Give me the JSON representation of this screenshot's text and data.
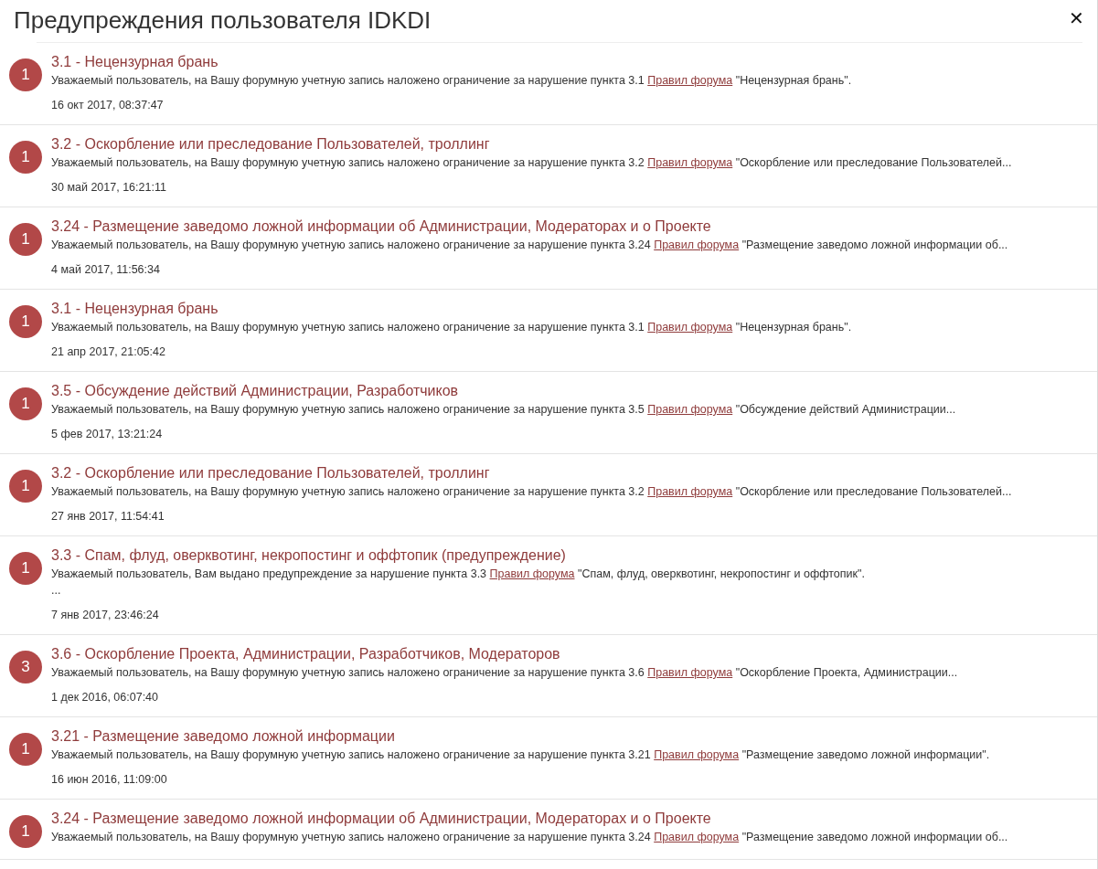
{
  "dialog": {
    "title": "Предупреждения пользователя IDKDI",
    "close": "✕"
  },
  "warnings": [
    {
      "count": "1",
      "title": "3.1 - Нецензурная брань",
      "body_before": "Уважаемый пользователь, на Вашу форумную учетную запись наложено ограничение за нарушение пункта 3.1",
      "link": "Правил форума",
      "body_after": "\"Нецензурная брань\".",
      "date": "16 окт 2017, 08:37:47"
    },
    {
      "count": "1",
      "title": "3.2 - Оскорбление или преследование Пользователей, троллинг",
      "body_before": "Уважаемый пользователь, на Вашу форумную учетную запись наложено ограничение за нарушение пункта 3.2",
      "link": "Правил форума",
      "body_after": "\"Оскорбление или преследование Пользователей...",
      "date": "30 май 2017, 16:21:11"
    },
    {
      "count": "1",
      "title": "3.24 - Размещение заведомо ложной информации об Администрации, Модераторах и о Проекте",
      "body_before": "Уважаемый пользователь, на Вашу форумную учетную запись наложено ограничение за нарушение пункта 3.24",
      "link": "Правил форума",
      "body_after": "\"Размещение заведомо ложной информации об...",
      "date": "4 май 2017, 11:56:34"
    },
    {
      "count": "1",
      "title": "3.1 - Нецензурная брань",
      "body_before": "Уважаемый пользователь, на Вашу форумную учетную запись наложено ограничение за нарушение пункта 3.1",
      "link": "Правил форума",
      "body_after": "\"Нецензурная брань\".",
      "date": "21 апр 2017, 21:05:42"
    },
    {
      "count": "1",
      "title": "3.5 - Обсуждение действий Администрации, Разработчиков",
      "body_before": "Уважаемый пользователь, на Вашу форумную учетную запись наложено ограничение за нарушение пункта 3.5",
      "link": "Правил форума",
      "body_after": "\"Обсуждение действий Администрации...",
      "date": "5 фев 2017, 13:21:24"
    },
    {
      "count": "1",
      "title": "3.2 - Оскорбление или преследование Пользователей, троллинг",
      "body_before": "Уважаемый пользователь, на Вашу форумную учетную запись наложено ограничение за нарушение пункта 3.2",
      "link": "Правил форума",
      "body_after": "\"Оскорбление или преследование Пользователей...",
      "date": "27 янв 2017, 11:54:41"
    },
    {
      "count": "1",
      "title": "3.3 - Спам, флуд, оверквотинг, некропостинг и оффтопик (предупреждение)",
      "body_before": "Уважаемый пользователь, Вам выдано предупреждение за нарушение пункта 3.3",
      "link": "Правил форума",
      "body_after": "\"Спам, флуд, оверквотинг, некропостинг и оффтопик\".",
      "extra_line": "...",
      "date": "7 янв 2017, 23:46:24"
    },
    {
      "count": "3",
      "title": "3.6 - Оскорбление Проекта, Администрации, Разработчиков, Модераторов",
      "body_before": "Уважаемый пользователь, на Вашу форумную учетную запись наложено ограничение за нарушение пункта 3.6",
      "link": "Правил форума",
      "body_after": "\"Оскорбление Проекта, Администрации...",
      "date": "1 дек 2016, 06:07:40"
    },
    {
      "count": "1",
      "title": "3.21 - Размещение заведомо ложной информации",
      "body_before": "Уважаемый пользователь, на Вашу форумную учетную запись наложено ограничение за нарушение пункта 3.21",
      "link": "Правил форума",
      "body_after": "\"Размещение заведомо ложной информации\".",
      "date": "16 июн 2016, 11:09:00"
    },
    {
      "count": "1",
      "title": "3.24 - Размещение заведомо ложной информации об Администрации, Модераторах и о Проекте",
      "body_before": "Уважаемый пользователь, на Вашу форумную учетную запись наложено ограничение за нарушение пункта 3.24",
      "link": "Правил форума",
      "body_after": "\"Размещение заведомо ложной информации об..."
    }
  ]
}
